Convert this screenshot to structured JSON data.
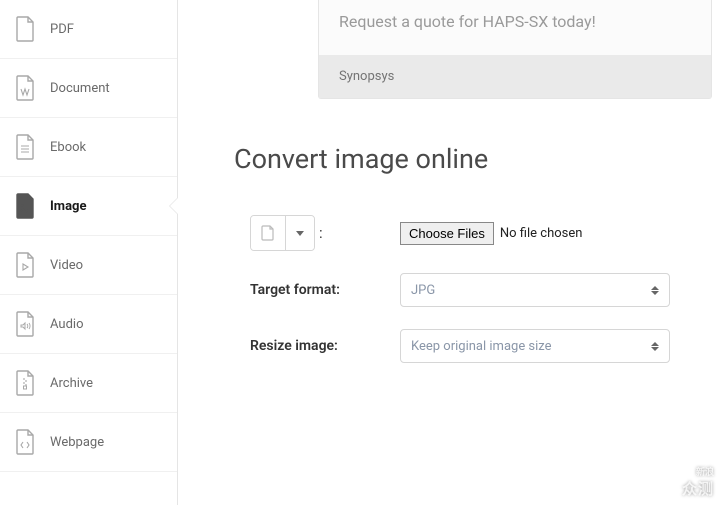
{
  "sidebar": {
    "items": [
      {
        "label": "PDF",
        "icon": "pdf"
      },
      {
        "label": "Document",
        "icon": "document"
      },
      {
        "label": "Ebook",
        "icon": "ebook"
      },
      {
        "label": "Image",
        "icon": "image",
        "active": true
      },
      {
        "label": "Video",
        "icon": "video"
      },
      {
        "label": "Audio",
        "icon": "audio"
      },
      {
        "label": "Archive",
        "icon": "archive"
      },
      {
        "label": "Webpage",
        "icon": "webpage"
      }
    ]
  },
  "ad": {
    "headline": "Request a quote for HAPS-SX today!",
    "brand": "Synopsys"
  },
  "page": {
    "title": "Convert image online"
  },
  "form": {
    "choose_files_label": "Choose Files",
    "no_file_text": "No file chosen",
    "target_format_label": "Target format:",
    "target_format_value": "JPG",
    "resize_label": "Resize image:",
    "resize_value": "Keep original image size"
  },
  "watermark": {
    "brand_small": "新浪",
    "brand_large": "众测"
  }
}
